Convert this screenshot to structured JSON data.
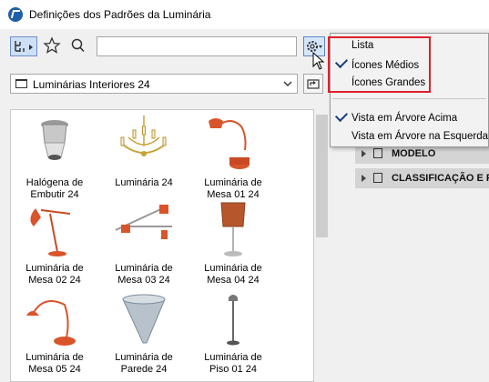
{
  "window": {
    "title": "Definições dos Padrões da Luminária"
  },
  "toolbar": {
    "view_icon": "tree-view-icon",
    "favorites_icon": "star-icon",
    "search_icon": "search-icon",
    "search_value": "",
    "settings_icon": "gear-icon"
  },
  "library": {
    "path": "Luminárias Interiores 24",
    "items": [
      {
        "line1": "Halógena de",
        "line2": "Embutir 24"
      },
      {
        "line1": "Luminária 24",
        "line2": ""
      },
      {
        "line1": "Luminária de",
        "line2": "Mesa 01 24"
      },
      {
        "line1": "Luminária de",
        "line2": "Mesa 02 24"
      },
      {
        "line1": "Luminária de",
        "line2": "Mesa 03 24"
      },
      {
        "line1": "Luminária de",
        "line2": "Mesa 04 24"
      },
      {
        "line1": "Luminária de",
        "line2": "Mesa 05 24"
      },
      {
        "line1": "Luminária de",
        "line2": "Parede 24"
      },
      {
        "line1": "Luminária de",
        "line2": "Piso 01 24"
      }
    ]
  },
  "menu": {
    "items": [
      {
        "label": "Lista",
        "checked": false
      },
      {
        "label": "Ícones Médios",
        "checked": true
      },
      {
        "label": "Ícones Grandes",
        "checked": false
      },
      {
        "label": "Vista em Árvore Acima",
        "checked": true
      },
      {
        "label": "Vista em Árvore na Esquerda",
        "checked": false
      }
    ]
  },
  "right_panel": {
    "sections": [
      {
        "label": "MODELO"
      },
      {
        "label": "CLASSIFICAÇÃO E P"
      }
    ]
  },
  "colors": {
    "accent": "#1f5ea8",
    "highlight": "#e0202a",
    "lamp_orange": "#d9542a"
  }
}
